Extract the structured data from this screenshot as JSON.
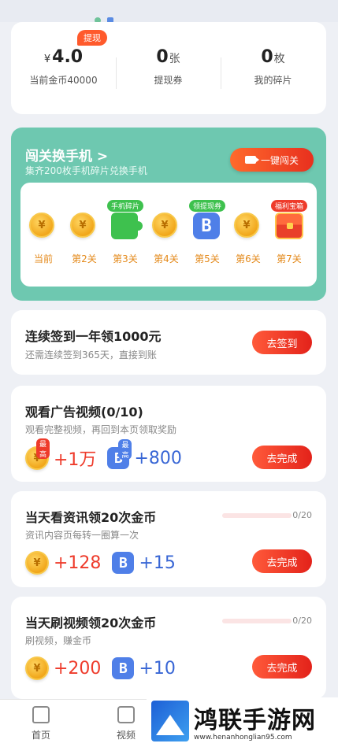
{
  "stats": {
    "withdraw_badge": "提现",
    "coins": {
      "currency": "¥",
      "value": "4.0",
      "label": "当前金币40000"
    },
    "coupons": {
      "value": "0",
      "unit": "张",
      "label": "提现券"
    },
    "fragments": {
      "value": "0",
      "unit": "枚",
      "label": "我的碎片"
    }
  },
  "levels": {
    "title": "闯关换手机 >",
    "subtitle": "集齐200枚手机碎片兑换手机",
    "onekey_button": "一键闯关",
    "steps": [
      {
        "label": "当前",
        "icon": "coin-icon",
        "tag": ""
      },
      {
        "label": "第2关",
        "icon": "coin-icon",
        "tag": ""
      },
      {
        "label": "第3关",
        "icon": "puzzle-icon",
        "tag": "手机碎片"
      },
      {
        "label": "第4关",
        "icon": "coin-icon",
        "tag": ""
      },
      {
        "label": "第5关",
        "icon": "coupon-icon",
        "tag": "领提现券"
      },
      {
        "label": "第6关",
        "icon": "coin-icon",
        "tag": ""
      },
      {
        "label": "第7关",
        "icon": "treasure-chest-icon",
        "tag": "福利宝箱"
      }
    ],
    "tag_colors": {
      "puzzle": "#3ec14e",
      "coupon": "#3ec14e",
      "chest": "#ee3b2b"
    }
  },
  "sign": {
    "title": "连续签到一年领1000元",
    "subtitle": "还需连续签到365天，直接到账",
    "button": "去签到"
  },
  "ad_task": {
    "title": "观看广告视频(0/10)",
    "subtitle": "观看完整视频，再回到本页领取奖励",
    "coin_tag": "最高",
    "coin_reward": "+1万",
    "coupon_tag": "最高",
    "coupon_reward": "+800",
    "button": "去完成"
  },
  "news_task": {
    "title": "当天看资讯领20次金币",
    "subtitle": "资讯内容页每转一圈算一次",
    "progress_text": "0/20",
    "progress": 0,
    "coin_reward": "+128",
    "coupon_reward": "+15",
    "button": "去完成"
  },
  "video_task": {
    "title": "当天刷视频领20次金币",
    "subtitle": "刷视频，赚金币",
    "progress_text": "0/20",
    "progress": 0,
    "coin_reward": "+200",
    "coupon_reward": "+10",
    "button": "去完成"
  },
  "nav": {
    "home": "首页",
    "video": "视频"
  },
  "watermark": {
    "text": "鸿联手游网",
    "url": "www.henanhonglian95.com"
  },
  "colors": {
    "accent_green": "#6ec8b0",
    "button_red": "#e3221a",
    "coin_red": "#ee3b2b",
    "coupon_blue": "#3866d5"
  }
}
